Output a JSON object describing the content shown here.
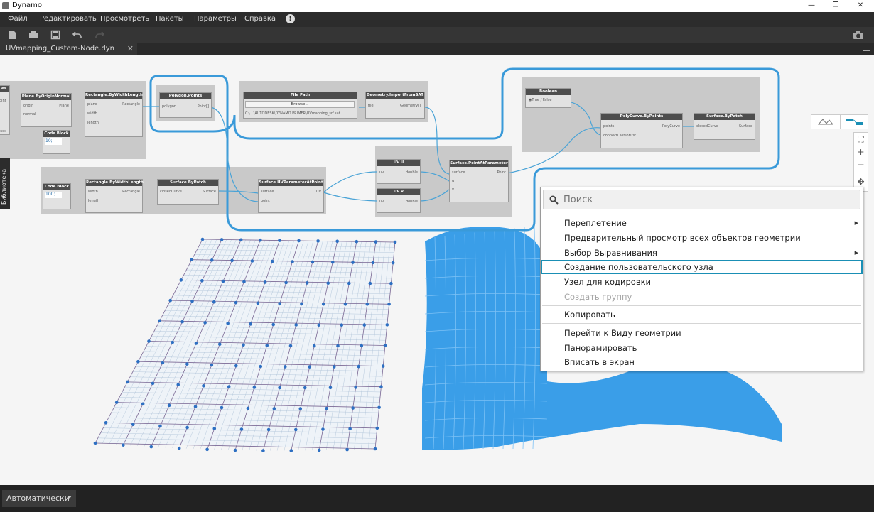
{
  "window": {
    "title": "Dynamo"
  },
  "menu": [
    "Файл",
    "Редактировать",
    "Просмотреть",
    "Пакеты",
    "Параметры",
    "Справка"
  ],
  "tab": {
    "label": "UVmapping_Custom-Node.dyn"
  },
  "library_tab": "Библиотека",
  "nodes": {
    "plane": {
      "title": "Plane.ByOriginNormal",
      "in": [
        "origin",
        "normal"
      ],
      "out": "Plane"
    },
    "rect1": {
      "title": "Rectangle.ByWidthLength",
      "in": [
        "plane",
        "width",
        "length"
      ],
      "out": "Rectangle"
    },
    "codeblock1": {
      "title": "Code Block",
      "code": "10;"
    },
    "polypoints": {
      "title": "Polygon.Points",
      "in": "polygon",
      "out": "Point[]"
    },
    "filepath": {
      "title": "File Path",
      "button": "Browse...",
      "path": "C:\\...\\AUTODESK\\DYNAMO PRIMER\\UVmapping_srf.sat"
    },
    "importsat": {
      "title": "Geometry.ImportFromSAT",
      "in": "file",
      "out": "Geometry[]"
    },
    "boolean": {
      "title": "Boolean",
      "opt_true": "True",
      "opt_false": "False"
    },
    "polycurve": {
      "title": "PolyCurve.ByPoints",
      "in": [
        "points",
        "connectLastToFirst"
      ],
      "out": "PolyCurve"
    },
    "patch2": {
      "title": "Surface.ByPatch",
      "in": "closedCurve",
      "out": "Surface"
    },
    "codeblock2": {
      "title": "Code Block",
      "code": "100;"
    },
    "rect2": {
      "title": "Rectangle.ByWidthLength",
      "in": [
        "width",
        "length"
      ],
      "out": "Rectangle"
    },
    "patch1": {
      "title": "Surface.ByPatch",
      "in": "closedCurve",
      "out": "Surface"
    },
    "uvparam": {
      "title": "Surface.UVParameterAtPoint",
      "in": [
        "surface",
        "point"
      ],
      "out": "UV"
    },
    "uvu": {
      "title": "UV.U",
      "in": "uv",
      "out": "double"
    },
    "uvv": {
      "title": "UV.V",
      "in": "uv",
      "out": "double"
    },
    "pointat": {
      "title": "Surface.PointAtParameter",
      "in": [
        "surface",
        "u",
        "v"
      ],
      "out": "Point"
    }
  },
  "context_menu": {
    "search_placeholder": "Поиск",
    "items": [
      {
        "label": "Переплетение",
        "submenu": true
      },
      {
        "label": "Предварительный просмотр всех объектов геометрии"
      },
      {
        "label": "Выбор Выравнивания",
        "submenu": true
      },
      {
        "label": "Создание пользовательского узла",
        "highlighted": true
      },
      {
        "label": "Узел для кодировки"
      },
      {
        "label": "Создать группу",
        "disabled": true
      },
      {
        "label": "Копировать"
      },
      {
        "label": "Перейти к Виду геометрии"
      },
      {
        "label": "Панорамировать"
      },
      {
        "label": "Вписать в экран"
      }
    ]
  },
  "status": {
    "run_mode": "Автоматически"
  },
  "colors": {
    "accent": "#1a8fb5",
    "selection": "#3a9ad9",
    "surface": "#3a9ee8"
  }
}
